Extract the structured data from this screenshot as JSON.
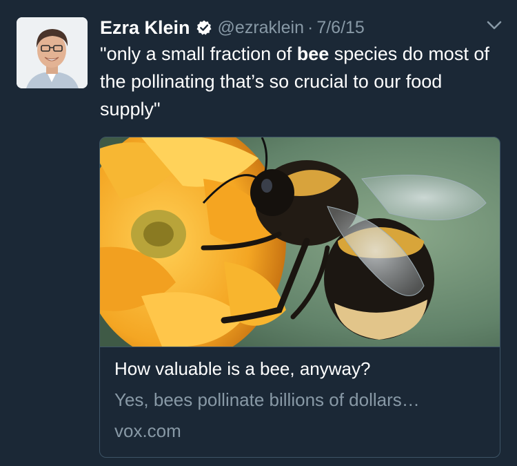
{
  "tweet": {
    "author_name": "Ezra Klein",
    "handle": "@ezraklein",
    "separator": "·",
    "date": "7/6/15",
    "text_before": "\"only a small fraction of ",
    "text_bold": "bee",
    "text_after": " species do most of the pollinating that’s so crucial to our food supply\""
  },
  "card": {
    "title": "How valuable is a bee, anyway?",
    "description": "Yes, bees pollinate billions of dollars…",
    "domain": "vox.com"
  },
  "icons": {
    "verified": "verified-badge-icon",
    "menu": "chevron-down-icon"
  },
  "colors": {
    "background": "#1b2836",
    "secondary_text": "#8899a6",
    "card_border": "#3d5466"
  }
}
